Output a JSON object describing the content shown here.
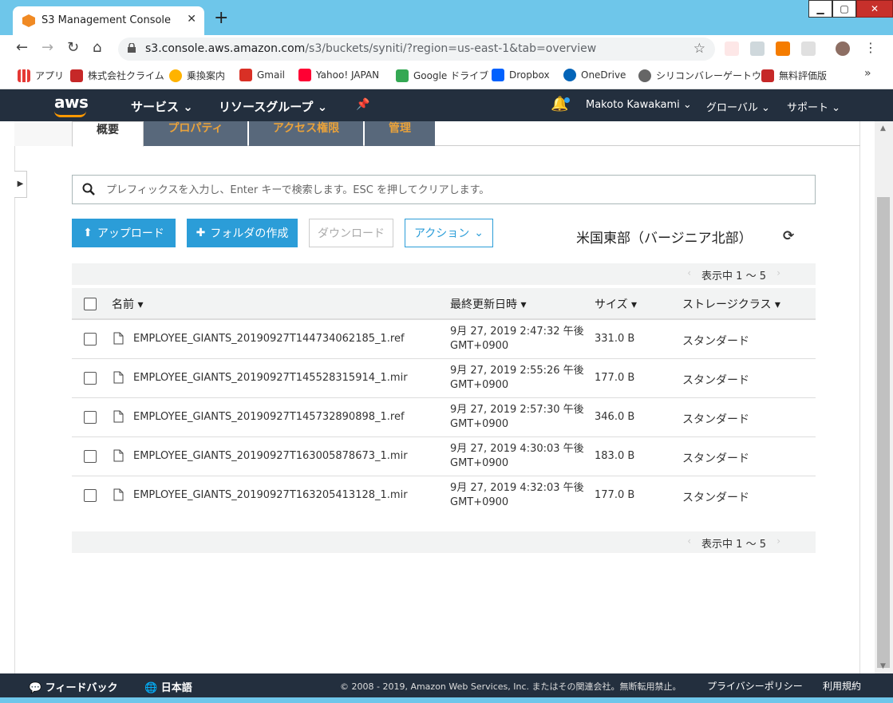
{
  "browser": {
    "tab_title": "S3 Management Console",
    "url_host": "s3.console.aws.amazon.com",
    "url_path": "/s3/buckets/syniti/?region=us-east-1&tab=overview",
    "bookmarks": [
      "アプリ",
      "株式会社クライム",
      "乗換案内",
      "Gmail",
      "Yahoo! JAPAN",
      "Google ドライブ",
      "Dropbox",
      "OneDrive",
      "シリコンバレーゲートウ…",
      "無料評価版"
    ]
  },
  "aws_header": {
    "logo": "aws",
    "services": "サービス",
    "resource_groups": "リソースグループ",
    "user": "Makoto Kawakami",
    "region_menu": "グローバル",
    "support": "サポート"
  },
  "tabs": [
    "概要",
    "プロパティ",
    "アクセス権限",
    "管理"
  ],
  "search": {
    "placeholder": "プレフィックスを入力し、Enter キーで検索します。ESC を押してクリアします。"
  },
  "actions": {
    "upload": "アップロード",
    "create_folder": "フォルダの作成",
    "download": "ダウンロード",
    "actions": "アクション"
  },
  "region_label": "米国東部（バージニア北部）",
  "pager_text": "表示中 1 ～ 5",
  "columns": {
    "name": "名前",
    "modified": "最終更新日時",
    "size": "サイズ",
    "storage_class": "ストレージクラス"
  },
  "files": [
    {
      "name": "EMPLOYEE_GIANTS_20190927T144734062185_1.ref",
      "date": "9月 27, 2019 2:47:32 午後",
      "tz": "GMT+0900",
      "size": "331.0 B",
      "class": "スタンダード"
    },
    {
      "name": "EMPLOYEE_GIANTS_20190927T145528315914_1.mir",
      "date": "9月 27, 2019 2:55:26 午後",
      "tz": "GMT+0900",
      "size": "177.0 B",
      "class": "スタンダード"
    },
    {
      "name": "EMPLOYEE_GIANTS_20190927T145732890898_1.ref",
      "date": "9月 27, 2019 2:57:30 午後",
      "tz": "GMT+0900",
      "size": "346.0 B",
      "class": "スタンダード"
    },
    {
      "name": "EMPLOYEE_GIANTS_20190927T163005878673_1.mir",
      "date": "9月 27, 2019 4:30:03 午後",
      "tz": "GMT+0900",
      "size": "183.0 B",
      "class": "スタンダード"
    },
    {
      "name": "EMPLOYEE_GIANTS_20190927T163205413128_1.mir",
      "date": "9月 27, 2019 4:32:03 午後",
      "tz": "GMT+0900",
      "size": "177.0 B",
      "class": "スタンダード"
    }
  ],
  "footer": {
    "feedback": "フィードバック",
    "language": "日本語",
    "copyright": "© 2008 - 2019, Amazon Web Services, Inc. またはその関連会社。無断転用禁止。",
    "privacy": "プライバシーポリシー",
    "terms": "利用規約"
  },
  "colors": {
    "aws_dark": "#232f3e",
    "primary": "#2b9dd8",
    "tab_inactive_bg": "#58687b",
    "tab_inactive_text": "#e9a23b",
    "chrome": "#6ec6ea"
  }
}
